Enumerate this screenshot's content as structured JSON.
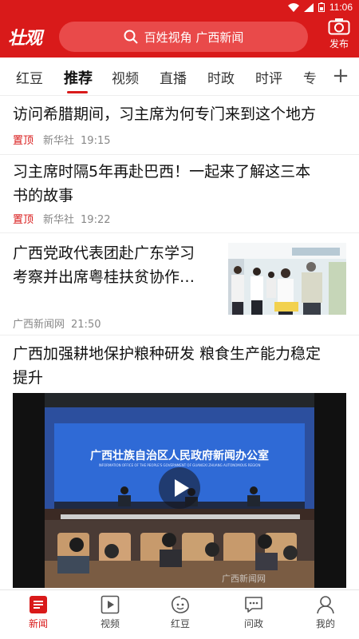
{
  "status_bar": {
    "time": "11:06"
  },
  "header": {
    "logo": "壮观",
    "search_placeholder": "百姓视角 广西新闻",
    "publish_label": "发布"
  },
  "tabs": [
    "红豆",
    "推荐",
    "视频",
    "直播",
    "时政",
    "时评",
    "专"
  ],
  "active_tab": "推荐",
  "articles": [
    {
      "title": "访问希腊期间，习主席为何专门来到这个地方",
      "pin": "置顶",
      "source": "新华社",
      "time": "19:15"
    },
    {
      "title_line1": "习主席时隔5年再赴巴西！一起来了解这三本",
      "title_line2": "书的故事",
      "pin": "置顶",
      "source": "新华社",
      "time": "19:22"
    },
    {
      "title_line1": "广西党政代表团赴广东学习",
      "title_line2": "考察并出席粤桂扶贫协作…",
      "source": "广西新闻网",
      "time": "21:50"
    },
    {
      "title_line1": "广西加强耕地保护粮种研发 粮食生产能力稳定",
      "title_line2": "提升"
    }
  ],
  "video": {
    "banner_cn": "广西壮族自治区人民政府新闻办公室",
    "banner_en": "INFORMATION OFFICE OF THE PEOPLE'S GOVERNMENT OF GUANGXI ZHUANG AUTONOMOUS REGION",
    "watermark": "广西新闻网"
  },
  "bottom_nav": [
    {
      "label": "新闻",
      "icon": "news-icon"
    },
    {
      "label": "视频",
      "icon": "video-icon"
    },
    {
      "label": "红豆",
      "icon": "hongdou-icon"
    },
    {
      "label": "问政",
      "icon": "chat-icon"
    },
    {
      "label": "我的",
      "icon": "user-icon"
    }
  ],
  "colors": {
    "brand": "#d91a1a",
    "search_bg": "#e94a4a"
  }
}
